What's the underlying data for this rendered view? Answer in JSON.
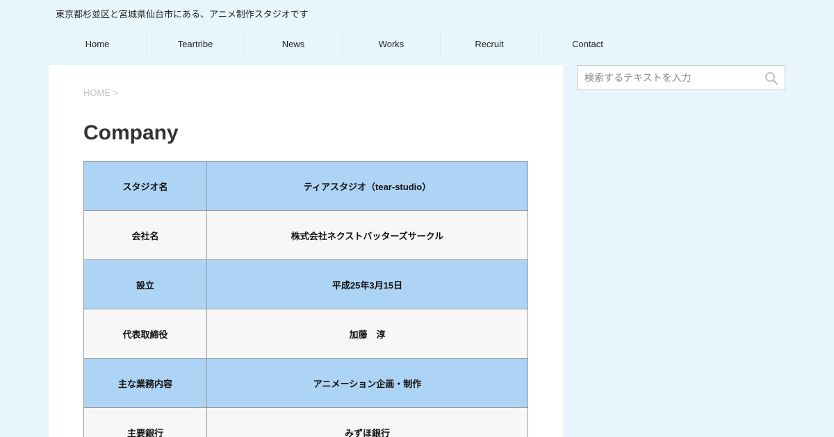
{
  "header": {
    "tagline": "東京都杉並区と宮城県仙台市にある、アニメ制作スタジオです"
  },
  "nav": {
    "items": [
      {
        "label": "Home"
      },
      {
        "label": "Teartribe"
      },
      {
        "label": "News"
      },
      {
        "label": "Works"
      },
      {
        "label": "Recruit"
      },
      {
        "label": "Contact"
      }
    ]
  },
  "breadcrumb": {
    "home": "HOME",
    "separator": ">"
  },
  "main": {
    "title": "Company"
  },
  "company_table": {
    "rows": [
      {
        "label": "スタジオ名",
        "value": "ティアスタジオ（tear-studio）",
        "style": "blue"
      },
      {
        "label": "会社名",
        "value": "株式会社ネクストバッターズサークル",
        "style": "gray"
      },
      {
        "label": "設立",
        "value": "平成25年3月15日",
        "style": "blue"
      },
      {
        "label": "代表取締役",
        "value": "加藤　淳",
        "style": "gray"
      },
      {
        "label": "主な業務内容",
        "value": "アニメーション企画・制作",
        "style": "blue"
      },
      {
        "label": "主要銀行",
        "value": "みずほ銀行",
        "style": "gray"
      }
    ]
  },
  "search": {
    "placeholder": "検索するテキストを入力",
    "icon": "search-icon"
  },
  "colors": {
    "page_background": "#e8f5fd",
    "row_blue": "#aed4f5",
    "row_gray": "#f7f7f7",
    "table_border": "#9a9a9a"
  }
}
